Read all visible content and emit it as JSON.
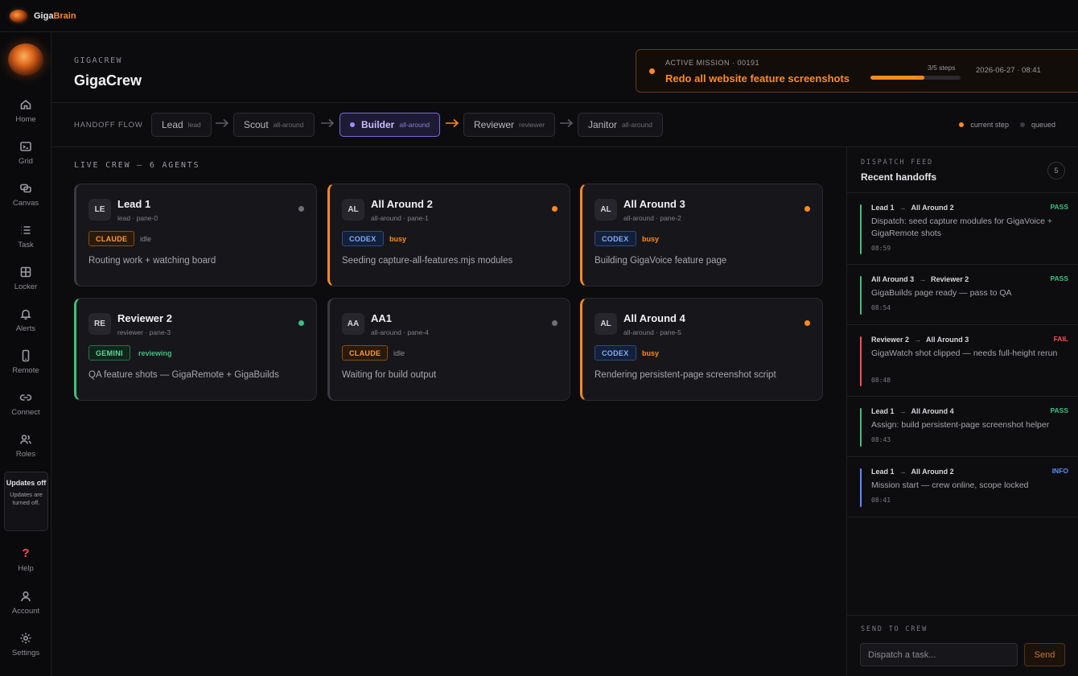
{
  "app": {
    "brand_main": "Giga",
    "brand_accent": "Brain"
  },
  "sidebar": {
    "items": [
      {
        "label": "Home",
        "icon": "home-icon"
      },
      {
        "label": "Grid",
        "icon": "terminal-icon"
      },
      {
        "label": "Canvas",
        "icon": "canvas-icon"
      },
      {
        "label": "Task",
        "icon": "list-icon"
      },
      {
        "label": "Locker",
        "icon": "locker-icon"
      },
      {
        "label": "Alerts",
        "icon": "bell-icon"
      },
      {
        "label": "Remote",
        "icon": "phone-icon"
      },
      {
        "label": "Connect",
        "icon": "link-icon"
      },
      {
        "label": "Roles",
        "icon": "users-icon"
      }
    ],
    "updates_title": "Updates off",
    "updates_subtitle": "Updates are turned off.",
    "bottom": [
      {
        "label": "Help",
        "icon": "help-icon"
      },
      {
        "label": "Account",
        "icon": "user-icon"
      },
      {
        "label": "Settings",
        "icon": "gear-icon"
      }
    ]
  },
  "header": {
    "eyebrow": "GIGACREW",
    "title": "GigaCrew",
    "mission": {
      "label": "ACTIVE MISSION · 00191",
      "title": "Redo all website feature screenshots",
      "steps_text": "3/5 steps",
      "progress": 0.6,
      "timestamp": "2026-06-27 · 08:41"
    }
  },
  "flow": {
    "label": "HANDOFF FLOW",
    "nodes": [
      {
        "name": "Lead",
        "role": "lead"
      },
      {
        "name": "Scout",
        "role": "all-around"
      },
      {
        "name": "Builder",
        "role": "all-around"
      },
      {
        "name": "Reviewer",
        "role": "reviewer"
      },
      {
        "name": "Janitor",
        "role": "all-around"
      }
    ],
    "legend_current": "current step",
    "legend_queued": "queued"
  },
  "crew": {
    "heading": "LIVE CREW — 6 AGENTS",
    "agents": [
      {
        "initials": "LE",
        "name": "Lead 1",
        "sub": "lead · pane-0",
        "model": "CLAUDE",
        "state": "idle",
        "task": "Routing work + watching board"
      },
      {
        "initials": "AL",
        "name": "All Around 2",
        "sub": "all-around · pane-1",
        "model": "CODEX",
        "state": "busy",
        "task": "Seeding capture-all-features.mjs modules"
      },
      {
        "initials": "AL",
        "name": "All Around 3",
        "sub": "all-around · pane-2",
        "model": "CODEX",
        "state": "busy",
        "task": "Building GigaVoice feature page"
      },
      {
        "initials": "RE",
        "name": "Reviewer 2",
        "sub": "reviewer · pane-3",
        "model": "GEMINI",
        "state": "reviewing",
        "task": "QA feature shots — GigaRemote + GigaBuilds"
      },
      {
        "initials": "AA",
        "name": "AA1",
        "sub": "all-around · pane-4",
        "model": "CLAUDE",
        "state": "idle",
        "task": "Waiting for build output"
      },
      {
        "initials": "AL",
        "name": "All Around 4",
        "sub": "all-around · pane-5",
        "model": "CODEX",
        "state": "busy",
        "task": "Rendering persistent-page screenshot script"
      }
    ]
  },
  "feed": {
    "eyebrow": "DISPATCH FEED",
    "title": "Recent handoffs",
    "count": "5",
    "items": [
      {
        "from": "Lead 1",
        "to": "All Around 2",
        "verdict": "PASS",
        "msg": "Dispatch: seed capture modules for GigaVoice + GigaRemote shots",
        "time": "08:59"
      },
      {
        "from": "All Around 3",
        "to": "Reviewer 2",
        "verdict": "PASS",
        "msg": "GigaBuilds page ready — pass to QA",
        "time": "08:54"
      },
      {
        "from": "Reviewer 2",
        "to": "All Around 3",
        "verdict": "FAIL",
        "msg": "GigaWatch shot clipped — needs full-height rerun",
        "time": "08:48"
      },
      {
        "from": "Lead 1",
        "to": "All Around 4",
        "verdict": "PASS",
        "msg": "Assign: build persistent-page screenshot helper",
        "time": "08:43"
      },
      {
        "from": "Lead 1",
        "to": "All Around 2",
        "verdict": "INFO",
        "msg": "Mission start — crew online, scope locked",
        "time": "08:41"
      }
    ]
  },
  "send": {
    "label": "SEND TO CREW",
    "placeholder": "Dispatch a task...",
    "button": "Send"
  },
  "colors": {
    "accent": "#ff8a1e",
    "pass": "#3fbf7f",
    "fail": "#ff4a5a",
    "info": "#5b8cff",
    "active_node": "#7c6ad8"
  }
}
